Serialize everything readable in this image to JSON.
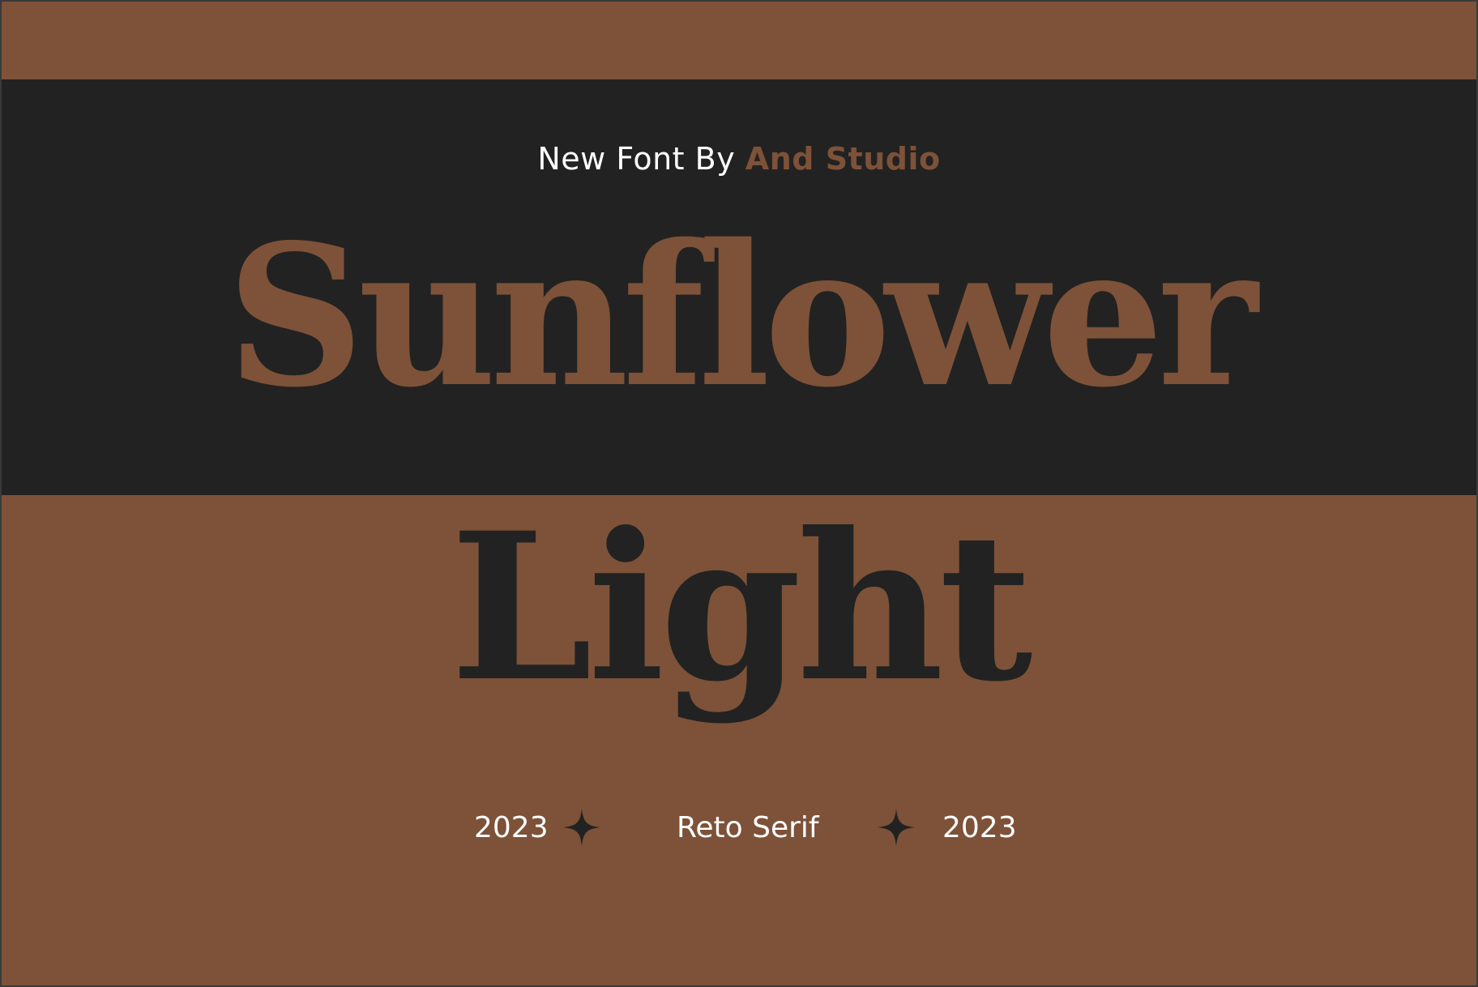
{
  "colors": {
    "background_brown": "#7d5238",
    "band_dark": "#222222",
    "text_light": "#ffffff"
  },
  "byline": {
    "prefix": "New Font By ",
    "studio": "And Studio"
  },
  "title": {
    "line1": "Sunflower",
    "line2": "Light"
  },
  "footer": {
    "year_left": "2023",
    "label": "Reto Serif",
    "year_right": "2023",
    "star_icon": "four-point-star"
  }
}
